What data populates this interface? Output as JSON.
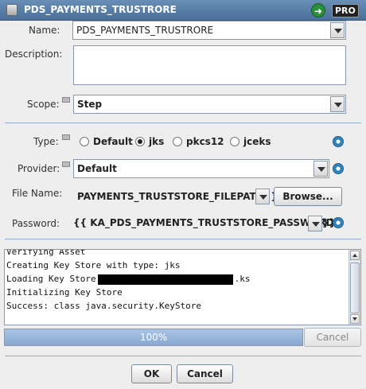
{
  "window": {
    "title": "PDS_PAYMENTS_TRUSTRORE",
    "badge": "PRO",
    "go_icon": "arrow-right-icon"
  },
  "form": {
    "name_label": "Name:",
    "name_value": "PDS_PAYMENTS_TRUSTRORE",
    "description_label": "Description:",
    "description_value": "",
    "scope_label": "Scope:",
    "scope_value": "Step",
    "type_label": "Type:",
    "type_options": [
      "Default",
      "jks",
      "pkcs12",
      "jceks"
    ],
    "type_selected": "jks",
    "provider_label": "Provider:",
    "provider_value": "Default",
    "filename_label": "File Name:",
    "filename_value": "PAYMENTS_TRUSTSTORE_FILEPATH}}",
    "browse_label": "Browse...",
    "password_label": "Password:",
    "password_prefix": "{{",
    "password_value": "KA_PDS_PAYMENTS_TRUSTSTORE_PASSWORD",
    "password_suffix": "}}"
  },
  "log": {
    "line0": "Verifying Asset",
    "line1": "Creating Key Store with type: jks",
    "line2_prefix": "Loading Key Store",
    "line2_suffix": ".ks",
    "line3": "Initializing Key Store",
    "line4": "Success: class java.security.KeyStore"
  },
  "progress": {
    "value": 100,
    "text": "100%",
    "cancel_label": "Cancel"
  },
  "footer": {
    "ok_label": "OK",
    "cancel_label": "Cancel"
  }
}
